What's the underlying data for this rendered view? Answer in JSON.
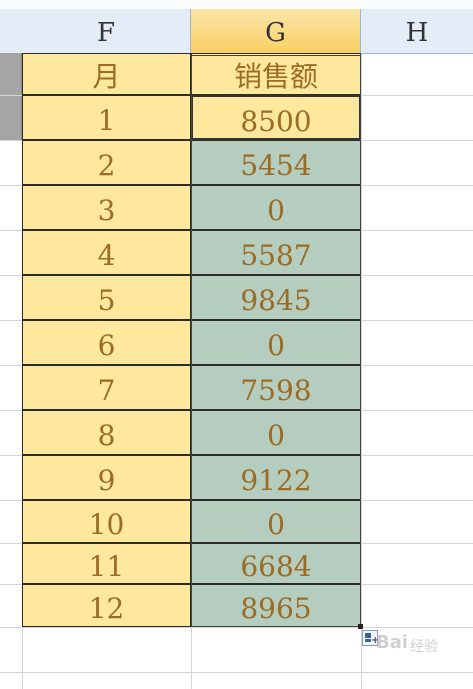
{
  "columns": [
    "F",
    "G",
    "H"
  ],
  "headers": {
    "month": "月",
    "sales": "销售额"
  },
  "rows": [
    {
      "month": "1",
      "sales": "8500"
    },
    {
      "month": "2",
      "sales": "5454"
    },
    {
      "month": "3",
      "sales": "0"
    },
    {
      "month": "4",
      "sales": "5587"
    },
    {
      "month": "5",
      "sales": "9845"
    },
    {
      "month": "6",
      "sales": "0"
    },
    {
      "month": "7",
      "sales": "7598"
    },
    {
      "month": "8",
      "sales": "0"
    },
    {
      "month": "9",
      "sales": "9122"
    },
    {
      "month": "10",
      "sales": "0"
    },
    {
      "month": "11",
      "sales": "6684"
    },
    {
      "month": "12",
      "sales": "8965"
    }
  ],
  "selected_column": "G",
  "active_cell": "G row 1",
  "colors": {
    "month_fill": "#fde89e",
    "sales_fill": "#b5cdbf",
    "text": "#9c6b24",
    "selected_header": "#f8cf63"
  },
  "icons": {
    "autofill": "auto-fill-options-icon"
  },
  "watermark": {
    "logo": "Bai",
    "text": "经验"
  }
}
